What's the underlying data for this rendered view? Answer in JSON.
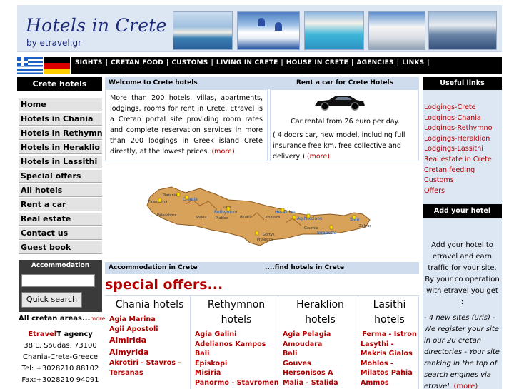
{
  "header": {
    "title": "Hotels in Crete",
    "subtitle": "by etravel.gr"
  },
  "nav": {
    "items": [
      "SIGHTS",
      "CRETAN FOOD",
      "CUSTOMS",
      "LIVING IN CRETE",
      "HOUSE IN CRETE",
      "AGENCIES",
      "LINKS"
    ],
    "separator": "|"
  },
  "left": {
    "header": "Crete hotels",
    "menu": [
      "Home",
      "Hotels in Chania",
      "Hotels in Rethymno",
      "Hotels in Heraklio",
      "Hotels in Lassithi",
      "Special offers",
      "All hotels",
      "Rent a car",
      "Real estate",
      "Contact us",
      "Guest book"
    ],
    "accommodation_title": "Accommodation",
    "search_value": "",
    "quick_search": "Quick search",
    "all_areas": "All cretan areas...",
    "all_areas_more": "more",
    "contact": {
      "brand_red": "Etravel",
      "brand_black": "T agency",
      "address": "38 L. Soudas, 73100",
      "city": "Chania-Crete-Greece",
      "tel": "Tel: +3028210 88102",
      "fax": "Fax:+3028210 94091"
    }
  },
  "center": {
    "welcome_title": "Welcome to Crete hotels",
    "welcome_text": "More than 200 hotels, villas, apartments, lodgings, rooms for rent in Crete. Etravel is a Cretan portal site providing room rates and complete reservation services in more than 200 lodgings in Greek island Crete directly, at the lowest prices.",
    "more": "(more)",
    "rentcar_title": "Rent a car for Crete Hotels",
    "car_price": "Car rental from 26 euro per day.",
    "car_desc": "( 4 doors car, new model, including full insurance free km, free collective and delivery )",
    "accom_title": "Accommodation in Crete",
    "find_title": "....find  hotels in Crete",
    "special_offers": "special offers...",
    "map_labels": [
      "Chania",
      "Platanias",
      "Falassarna",
      "Paleochora",
      "Sfakia",
      "Rethymnon",
      "Plakias",
      "Amari",
      "Zeus",
      "Heraklion",
      "Knossos",
      "Ag.Nikolaos",
      "Gortys",
      "Phaestos",
      "Gournia",
      "Ierapetra",
      "Sitia",
      "Zakros"
    ],
    "columns": [
      {
        "title": "Chania hotels",
        "items": [
          "Agia Marina",
          "Agii Apostoli",
          "Almirida",
          "Almyrida",
          "Akrotiri - Stavros - Tersanas"
        ]
      },
      {
        "title": "Rethymnon hotels",
        "items": [
          "Agia Galini",
          "Adelianos Kampos",
          "Bali",
          "Episkopi",
          "Misiria",
          "Panormo - Stavromenos"
        ]
      },
      {
        "title": "Heraklion hotels",
        "items": [
          "Agia Pelagia",
          "Amoudara",
          "Bali",
          "Gouves",
          "Hersonisos A",
          "Malia - Stalida"
        ]
      },
      {
        "title": "Lasithi hotels",
        "items": [
          "Ferma - Istron",
          "Lasythi - Makris Gialos Mohlos - Milatos Pahia Ammos"
        ]
      }
    ]
  },
  "right": {
    "useful_header": "Useful links",
    "links": [
      "Lodgings-Crete",
      "Lodgings-Chania",
      "Lodgings-Rethymno",
      "Lodgings-Heraklion",
      "Lodgings-Lassithi",
      "Real estate in Crete",
      "Cretan feeding",
      "Customs",
      "Offers"
    ],
    "add_header": "Add your hotel",
    "add_intro": "Add your hotel to etravel and earn traffic for your site. By your co operation with etravel you get :",
    "add_list": "- 4 new sites (urls) - We register your site in our 20 cretan directories - Your site ranking in the top of search engines via etravel.",
    "add_more": "(more)"
  },
  "colors": {
    "accent_red": "#b00000",
    "header_blue": "#dde6f3",
    "title_blue": "#1c2b78",
    "bar_blue": "#cfdcee",
    "nav_black": "#000000",
    "map_land": "#d8a25a"
  }
}
